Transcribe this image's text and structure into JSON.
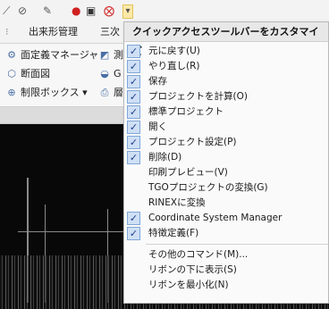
{
  "qat": {
    "icons": [
      "tool-icon",
      "eraser-icon",
      "pen-icon",
      "record-icon",
      "save-icon",
      "close-circle-icon",
      "customize-dropdown-icon"
    ],
    "glyphs": [
      "⟋",
      "⊘",
      "✎",
      "●",
      "▣",
      "⨂",
      "▾"
    ]
  },
  "tabs": [
    "出来形管理",
    "三次"
  ],
  "ribbon": {
    "items": [
      {
        "icon": "⚙",
        "label": "面定義マネージャ"
      },
      {
        "icon": "◩",
        "label": "測"
      },
      {
        "icon": "⬡",
        "label": "断面図"
      },
      {
        "icon": "◒",
        "label": "G"
      },
      {
        "icon": "⊕",
        "label": "制限ボックス ▾"
      },
      {
        "icon": "⎙",
        "label": "層"
      }
    ]
  },
  "menu": {
    "title": "クイックアクセスツールバーをカスタマイズ",
    "group1": [
      {
        "label": "元に戻す(U)",
        "checked": true
      },
      {
        "label": "やり直し(R)",
        "checked": true
      },
      {
        "label": "保存",
        "checked": true
      },
      {
        "label": "プロジェクトを計算(O)",
        "checked": true
      },
      {
        "label": "標準プロジェクト",
        "checked": true
      },
      {
        "label": "開く",
        "checked": true
      },
      {
        "label": "プロジェクト設定(P)",
        "checked": true
      },
      {
        "label": "削除(D)",
        "checked": true
      },
      {
        "label": "印刷プレビュー(V)",
        "checked": false
      },
      {
        "label": "TGOプロジェクトの変換(G)",
        "checked": false
      },
      {
        "label": "RINEXに変換",
        "checked": false
      },
      {
        "label": "Coordinate System Manager",
        "checked": true
      },
      {
        "label": "特徴定義(F)",
        "checked": true
      }
    ],
    "group2": [
      {
        "label": "その他のコマンド(M)..."
      },
      {
        "label": "リボンの下に表示(S)"
      },
      {
        "label": "リボンを最小化(N)"
      }
    ],
    "check_glyph": "✓"
  }
}
